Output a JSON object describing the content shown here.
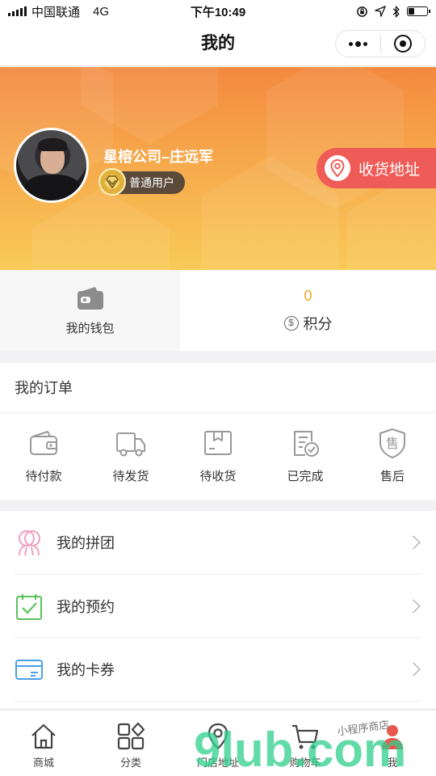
{
  "status_bar": {
    "carrier": "中国联通",
    "network": "4G",
    "time": "下午10:49"
  },
  "nav": {
    "title": "我的"
  },
  "profile": {
    "name": "星榕公司–庄远军",
    "level": "普通用户",
    "address_button": "收货地址"
  },
  "stats": {
    "wallet_label": "我的钱包",
    "points_value": "0",
    "points_label": "积分",
    "points_symbol": "$"
  },
  "orders": {
    "title": "我的订单",
    "items": [
      {
        "label": "待付款",
        "icon": "wallet-outline-icon"
      },
      {
        "label": "待发货",
        "icon": "truck-icon"
      },
      {
        "label": "待收货",
        "icon": "package-icon"
      },
      {
        "label": "已完成",
        "icon": "checked-document-icon"
      },
      {
        "label": "售后",
        "icon": "shield-icon",
        "icon_text": "售"
      }
    ]
  },
  "menu": [
    {
      "label": "我的拼团",
      "icon": "group-users-icon",
      "color": "#f2a0c0"
    },
    {
      "label": "我的预约",
      "icon": "calendar-check-icon",
      "color": "#5cc25c"
    },
    {
      "label": "我的卡券",
      "icon": "card-icon",
      "color": "#4aa0e6"
    }
  ],
  "tabs": [
    {
      "label": "商城",
      "icon": "home-icon"
    },
    {
      "label": "分类",
      "icon": "category-grid-icon"
    },
    {
      "label": "门店地址",
      "icon": "location-pin-icon"
    },
    {
      "label": "购物车",
      "icon": "cart-icon"
    },
    {
      "label": "我",
      "icon": "person-icon"
    }
  ],
  "watermark": {
    "text": "9lub.com",
    "caption": "小程序商店"
  },
  "colors": {
    "accent": "#ef5b57",
    "points": "#f5a623",
    "banner_top": "#f4893f",
    "banner_bottom": "#f9ca58"
  }
}
